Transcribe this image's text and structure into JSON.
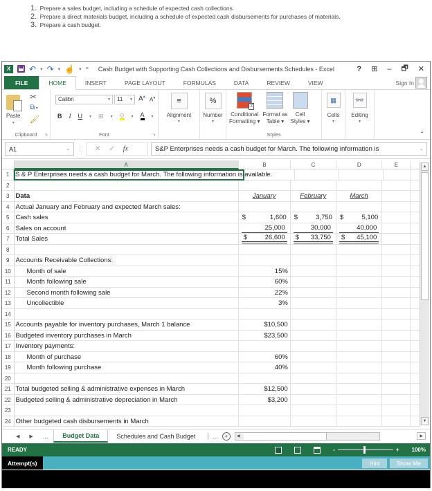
{
  "instructions": [
    {
      "num": "1.",
      "text": "Prepare a sales budget, including a schedule of expected cash collections."
    },
    {
      "num": "2.",
      "text": "Prepare a direct materials budget, including a schedule of expected cash disbursements for purchases of materials."
    },
    {
      "num": "3.",
      "text": "Prepare a cash budget."
    }
  ],
  "window": {
    "title": "Cash Budget with Supporting Cash Collections and Disbursements Schedules - Excel",
    "logo": "X",
    "help": "?",
    "restore_ribbon": "⊞",
    "minimize": "–",
    "maximize": "🗗",
    "close": "✕"
  },
  "ribbon_tabs": [
    "FILE",
    "HOME",
    "INSERT",
    "PAGE LAYOUT",
    "FORMULAS",
    "DATA",
    "REVIEW",
    "VIEW"
  ],
  "active_tab": "HOME",
  "sign_in": "Sign In",
  "ribbon": {
    "clipboard": {
      "paste": "Paste",
      "label": "Clipboard"
    },
    "font": {
      "name": "Calibri",
      "size": "11",
      "label": "Font",
      "bold": "B",
      "italic": "I",
      "underline": "U"
    },
    "alignment": {
      "label": "Alignment",
      "icon": "≡"
    },
    "number": {
      "label": "Number",
      "icon": "%"
    },
    "styles": {
      "conditional": "Conditional",
      "conditional2": "Formatting ▾",
      "format_table": "Format as",
      "format_table2": "Table ▾",
      "cell_styles": "Cell",
      "cell_styles2": "Styles ▾",
      "label": "Styles"
    },
    "cells": {
      "label": "Cells"
    },
    "editing": {
      "label": "Editing"
    }
  },
  "formula_bar": {
    "name_box": "A1",
    "formula": "S&P Enterprises needs a cash budget for March. The following information is"
  },
  "columns": [
    "A",
    "B",
    "C",
    "D",
    "E"
  ],
  "rows": [
    {
      "n": "1",
      "a": "S & P Enterprises needs a cash budget for March. The following information is available."
    },
    {
      "n": "2"
    },
    {
      "n": "3",
      "a": "Data",
      "b": "January",
      "c": "February",
      "d": "March"
    },
    {
      "n": "4",
      "a": "Actual January and February and expected March sales:"
    },
    {
      "n": "5",
      "a": "Cash sales",
      "b": "1,600",
      "c": "3,750",
      "d": "5,100"
    },
    {
      "n": "6",
      "a": "Sales on account",
      "b": "25,000",
      "c": "30,000",
      "d": "40,000"
    },
    {
      "n": "7",
      "a": "Total Sales",
      "b": "26,600",
      "c": "33,750",
      "d": "45,100"
    },
    {
      "n": "8"
    },
    {
      "n": "9",
      "a": "Accounts Receivable Collections:"
    },
    {
      "n": "10",
      "a": "Month of sale",
      "b": "15%"
    },
    {
      "n": "11",
      "a": "Month following sale",
      "b": "60%"
    },
    {
      "n": "12",
      "a": "Second month following sale",
      "b": "22%"
    },
    {
      "n": "13",
      "a": "Uncollectible",
      "b": "3%"
    },
    {
      "n": "14"
    },
    {
      "n": "15",
      "a": "Accounts payable for inventory purchases, March 1 balance",
      "b": "$10,500"
    },
    {
      "n": "16",
      "a": "Budgeted inventory purchases in March",
      "b": "$23,500"
    },
    {
      "n": "17",
      "a": "Inventory payments:"
    },
    {
      "n": "18",
      "a": "Month of purchase",
      "b": "60%"
    },
    {
      "n": "19",
      "a": "Month following purchase",
      "b": "40%"
    },
    {
      "n": "20"
    },
    {
      "n": "21",
      "a": "Total budgeted selling & administrative expenses in March",
      "b": "$12,500"
    },
    {
      "n": "22",
      "a": "Budgeted selling & administrative depreciation in March",
      "b": "$3,200"
    },
    {
      "n": "23"
    },
    {
      "n": "24",
      "a": "Other budgeted cash disbursements in March"
    }
  ],
  "currency_symbol": "$",
  "sheets": {
    "ellipsis": "...",
    "active": "Budget Data",
    "other": "Schedules and Cash Budget"
  },
  "status": {
    "text": "READY",
    "zoom": "100%"
  },
  "attempts": {
    "label": "Attempt(s)",
    "hint": "Hint",
    "show_me": "Show Me"
  },
  "colors": {
    "excel_green": "#217346",
    "attempts_bar": "#49b0c2"
  }
}
